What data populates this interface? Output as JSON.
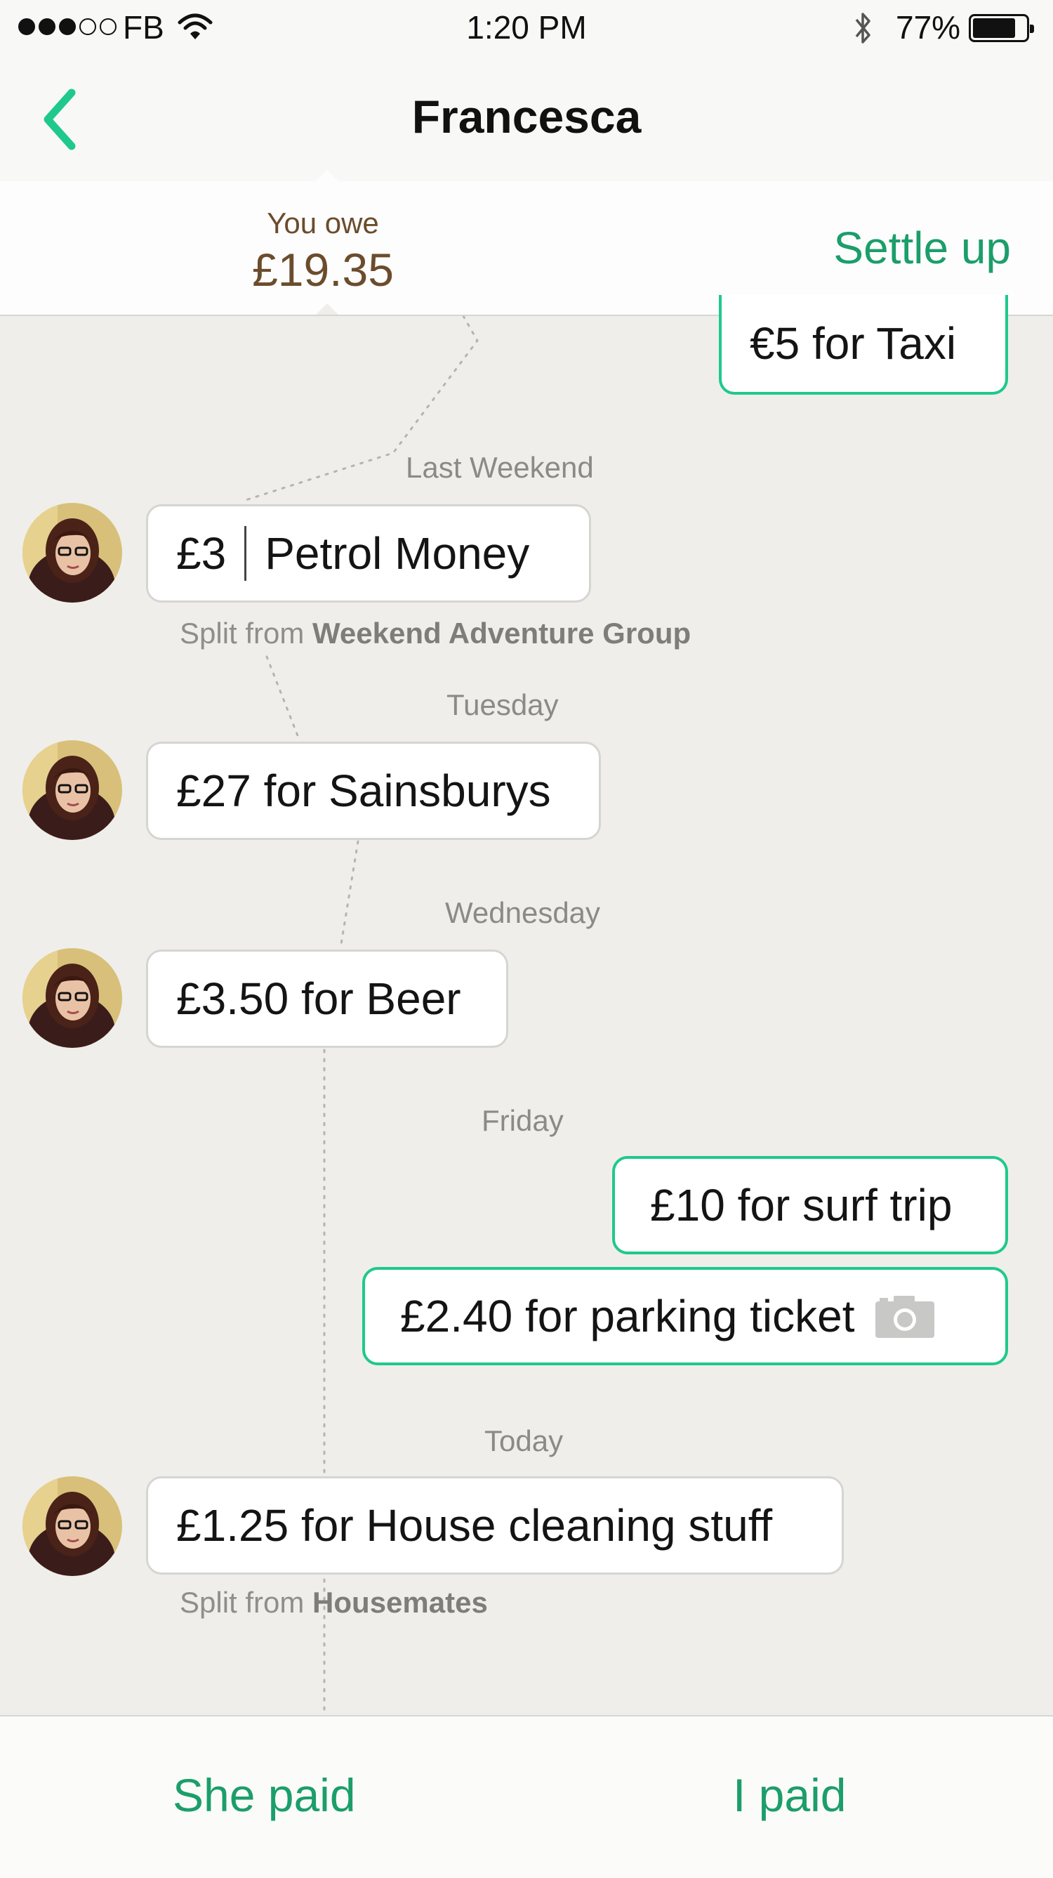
{
  "status_bar": {
    "carrier": "FB",
    "time": "1:20 PM",
    "battery": "77%",
    "signal_dots": 5,
    "signal_filled": 3,
    "battery_level": 0.77
  },
  "header": {
    "title": "Francesca",
    "back_icon": "chevron-left-icon"
  },
  "balance": {
    "label": "You owe",
    "amount": "£19.35",
    "settle_label": "Settle up"
  },
  "timeline": {
    "top_bubble": "€5 for Taxi",
    "dates": {
      "last_weekend": "Last Weekend",
      "tuesday": "Tuesday",
      "wednesday": "Wednesday",
      "friday": "Friday",
      "today": "Today"
    },
    "petrol": {
      "amount": "£3",
      "desc": "Petrol Money",
      "split_prefix": "Split from",
      "split_group": "Weekend Adventure Group"
    },
    "sainsburys": "£27 for Sainsburys",
    "beer": "£3.50 for Beer",
    "surf": "£10 for surf trip",
    "parking": "£2.40 for parking ticket",
    "cleaning": {
      "text": "£1.25 for House cleaning stuff",
      "split_prefix": "Split from",
      "split_group": "Housemates"
    }
  },
  "footer": {
    "she_paid": "She paid",
    "i_paid": "I paid"
  },
  "colors": {
    "accent": "#1c9e6a",
    "bubble_border_mine": "#1fc98b",
    "owe_text": "#6b4c2c",
    "background": "#efeeea"
  }
}
